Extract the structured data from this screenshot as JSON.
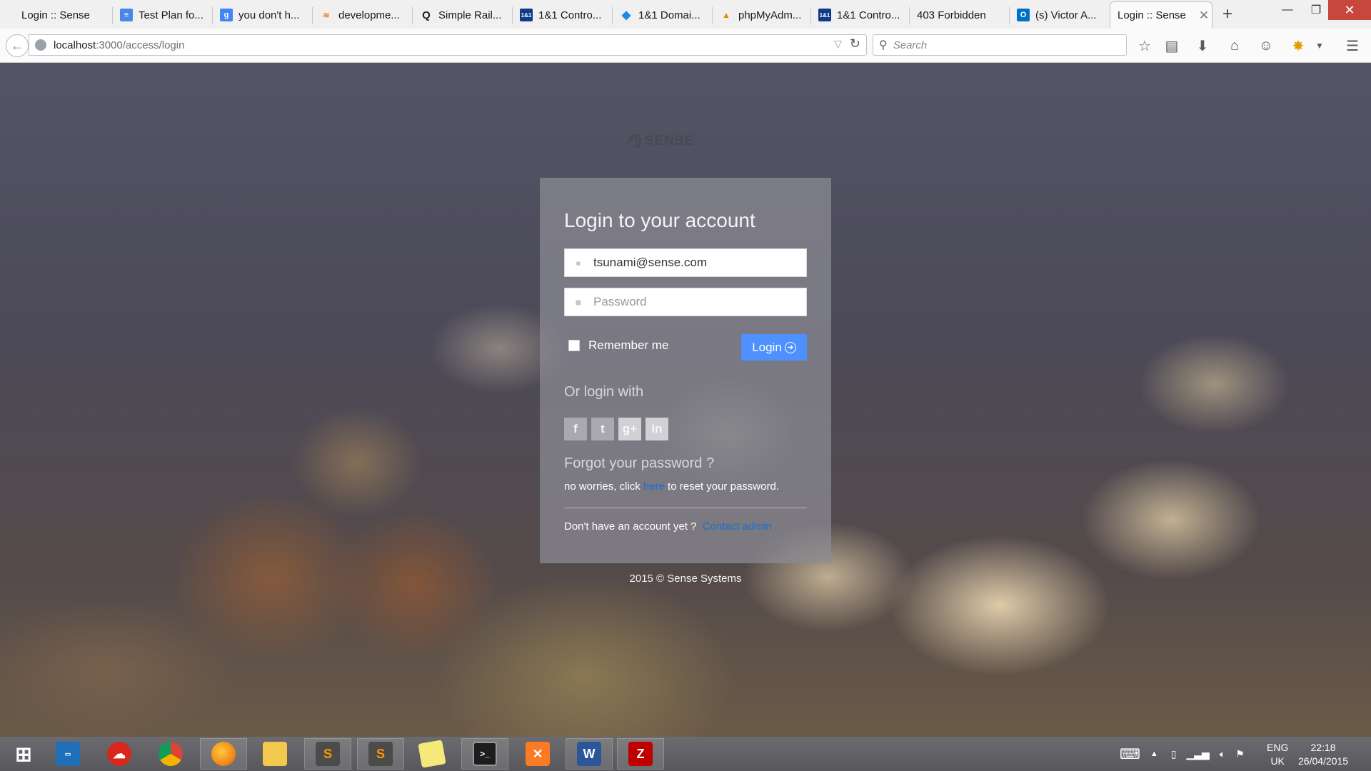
{
  "browser": {
    "tabs": [
      {
        "label": "Login :: Sense",
        "icon": "page-icon",
        "active": false
      },
      {
        "label": "Test Plan fo...",
        "icon": "docs-icon",
        "active": false
      },
      {
        "label": "you don't h...",
        "icon": "google-icon",
        "active": false
      },
      {
        "label": "developme...",
        "icon": "stackoverflow-icon",
        "active": false
      },
      {
        "label": "Simple Rail...",
        "icon": "search-icon",
        "active": false
      },
      {
        "label": "1&1 Contro...",
        "icon": "oneandone-icon",
        "active": false
      },
      {
        "label": "1&1 Domai...",
        "icon": "domain-icon",
        "active": false
      },
      {
        "label": "phpMyAdm...",
        "icon": "phpmyadmin-icon",
        "active": false
      },
      {
        "label": "1&1 Contro...",
        "icon": "oneandone-icon",
        "active": false
      },
      {
        "label": "403 Forbidden",
        "icon": "none",
        "active": false
      },
      {
        "label": "(s) Victor A...",
        "icon": "outlook-icon",
        "active": false
      },
      {
        "label": "Login :: Sense",
        "icon": "none",
        "active": true
      }
    ],
    "url_host": "localhost",
    "url_path": ":3000/access/login",
    "search_placeholder": "Search"
  },
  "page": {
    "brand": "SENSE",
    "login_title": "Login to your account",
    "email_value": "tsunami@sense.com",
    "password_placeholder": "Password",
    "remember_label": "Remember me",
    "login_button": "Login",
    "or_login_with": "Or login with",
    "socials": [
      {
        "label": "f",
        "name": "facebook"
      },
      {
        "label": "t",
        "name": "twitter"
      },
      {
        "label": "g+",
        "name": "google-plus"
      },
      {
        "label": "in",
        "name": "linkedin"
      }
    ],
    "forgot_title": "Forgot your password ?",
    "forgot_prefix": "no worries, click ",
    "forgot_link": "here",
    "forgot_suffix": " to reset your password.",
    "no_account_text": "Don't have an account yet ?",
    "contact_admin": "Contact admin",
    "footer": "2015 © Sense Systems"
  },
  "taskbar": {
    "lang_top": "ENG",
    "lang_bottom": "UK",
    "time": "22:18",
    "date": "26/04/2015"
  },
  "colors": {
    "accent": "#4d90fe",
    "link": "#1e6fd0"
  }
}
